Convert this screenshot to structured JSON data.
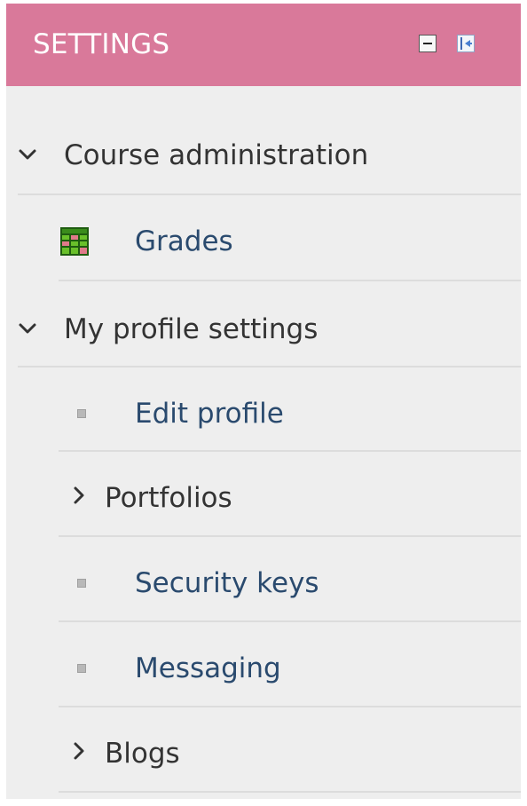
{
  "header": {
    "title": "SETTINGS"
  },
  "nav": {
    "course_admin": {
      "label": "Course administration",
      "expanded": true
    },
    "grades": {
      "label": "Grades"
    },
    "profile_settings": {
      "label": "My profile settings",
      "expanded": true
    },
    "edit_profile": {
      "label": "Edit profile"
    },
    "portfolios": {
      "label": "Portfolios",
      "expanded": false
    },
    "security_keys": {
      "label": "Security keys"
    },
    "messaging": {
      "label": "Messaging"
    },
    "blogs": {
      "label": "Blogs",
      "expanded": false
    }
  },
  "colors": {
    "header_bg": "#d9799a",
    "panel_bg": "#eeeeee",
    "link_text": "#2a4a6e"
  }
}
